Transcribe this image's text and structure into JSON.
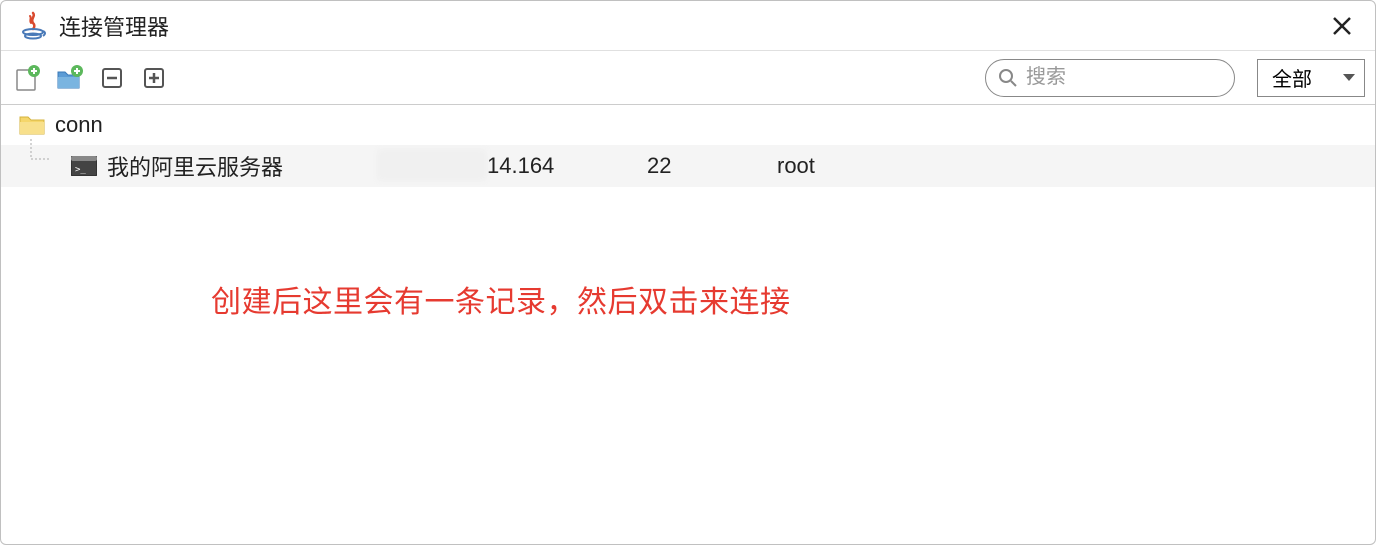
{
  "window": {
    "title": "连接管理器"
  },
  "toolbar": {
    "icons": {
      "new_file": "new-file-icon",
      "new_folder": "new-folder-icon",
      "collapse": "collapse-icon",
      "expand": "expand-icon"
    }
  },
  "search": {
    "placeholder": "搜索"
  },
  "filter": {
    "selected": "全部"
  },
  "tree": {
    "folder": {
      "name": "conn"
    },
    "items": [
      {
        "name": "我的阿里云服务器",
        "ip": "14.164",
        "port": "22",
        "user": "root"
      }
    ]
  },
  "annotation": {
    "text": "创建后这里会有一条记录，然后双击来连接"
  }
}
